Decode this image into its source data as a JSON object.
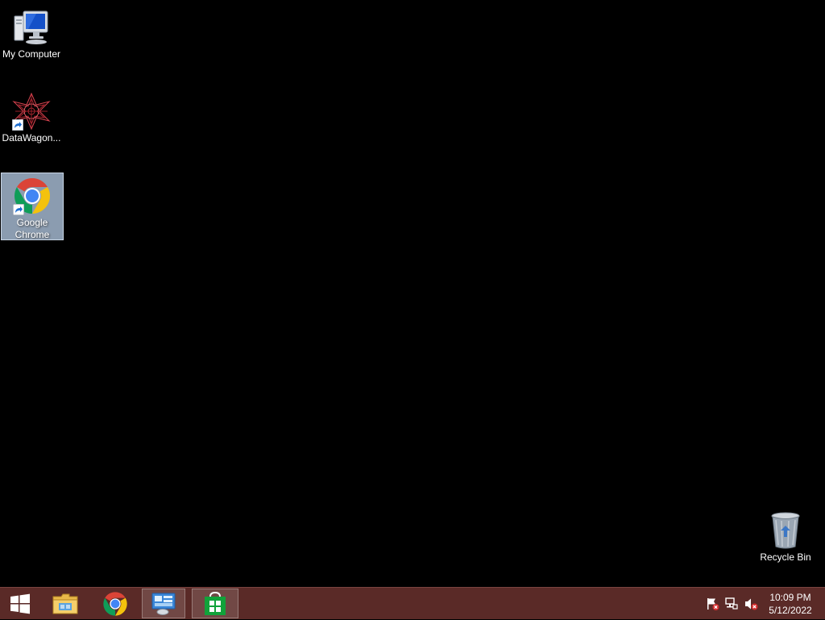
{
  "desktop": {
    "icons": [
      {
        "label": "My Computer",
        "icon": "computer-icon",
        "selected": false
      },
      {
        "label": "DataWagon...",
        "icon": "datawagon-icon",
        "selected": false,
        "shortcut": true
      },
      {
        "label": "Google\nChrome",
        "icon": "chrome-icon",
        "selected": true,
        "shortcut": true
      },
      {
        "label": "Recycle Bin",
        "icon": "recycle-bin-icon",
        "selected": false
      }
    ]
  },
  "taskbar": {
    "start": {
      "icon": "windows-start-icon"
    },
    "pinned": [
      {
        "name": "File Explorer",
        "icon": "folder-icon",
        "active": false
      },
      {
        "name": "Google Chrome",
        "icon": "chrome-icon",
        "active": false
      },
      {
        "name": "Server Manager",
        "icon": "server-manager-icon",
        "active": true
      },
      {
        "name": "Store",
        "icon": "store-icon",
        "active": true
      }
    ],
    "tray": [
      {
        "icon": "action-center-flag-icon"
      },
      {
        "icon": "network-icon"
      },
      {
        "icon": "volume-muted-icon"
      }
    ],
    "clock": {
      "time": "10:09 PM",
      "date": "5/12/2022"
    }
  },
  "colors": {
    "desktop_bg": "#000000",
    "taskbar_bg": "#5a2a27",
    "selection": "#aabed7"
  }
}
